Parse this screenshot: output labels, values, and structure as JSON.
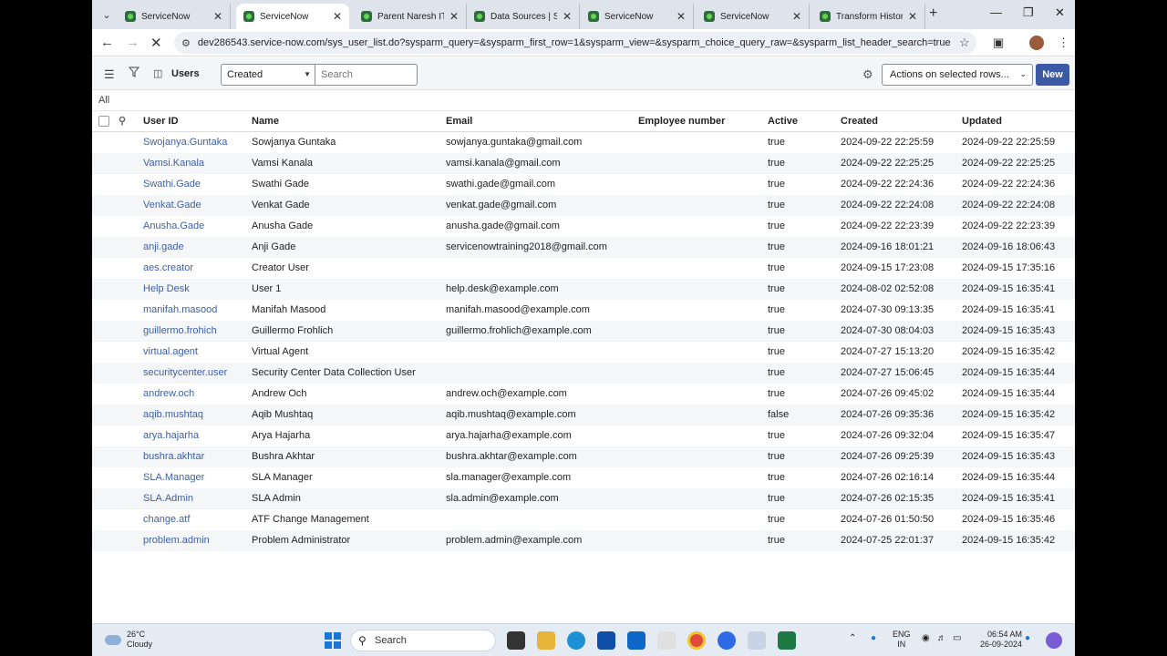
{
  "browser": {
    "tabs": [
      {
        "label": "ServiceNow",
        "active": false
      },
      {
        "label": "ServiceNow",
        "active": true
      },
      {
        "label": "Parent Naresh ITs",
        "active": false
      },
      {
        "label": "Data Sources | Ser",
        "active": false
      },
      {
        "label": "ServiceNow",
        "active": false
      },
      {
        "label": "ServiceNow",
        "active": false
      },
      {
        "label": "Transform Historic",
        "active": false
      }
    ],
    "url": "dev286543.service-now.com/sys_user_list.do?sysparm_query=&sysparm_first_row=1&sysparm_view=&sysparm_choice_query_raw=&sysparm_list_header_search=true"
  },
  "list": {
    "title": "Users",
    "search_field": "Created",
    "search_placeholder": "Search",
    "actions_label": "Actions on selected rows...",
    "new_label": "New",
    "breadcrumb": "All",
    "columns": [
      "User ID",
      "Name",
      "Email",
      "Employee number",
      "Active",
      "Created",
      "Updated"
    ],
    "rows": [
      [
        "Swojanya.Guntaka",
        "Sowjanya Guntaka",
        "sowjanya.guntaka@gmail.com",
        "",
        "true",
        "2024-09-22 22:25:59",
        "2024-09-22 22:25:59"
      ],
      [
        "Vamsi.Kanala",
        "Vamsi Kanala",
        "vamsi.kanala@gmail.com",
        "",
        "true",
        "2024-09-22 22:25:25",
        "2024-09-22 22:25:25"
      ],
      [
        "Swathi.Gade",
        "Swathi Gade",
        "swathi.gade@gmail.com",
        "",
        "true",
        "2024-09-22 22:24:36",
        "2024-09-22 22:24:36"
      ],
      [
        "Venkat.Gade",
        "Venkat Gade",
        "venkat.gade@gmail.com",
        "",
        "true",
        "2024-09-22 22:24:08",
        "2024-09-22 22:24:08"
      ],
      [
        "Anusha.Gade",
        "Anusha Gade",
        "anusha.gade@gmail.com",
        "",
        "true",
        "2024-09-22 22:23:39",
        "2024-09-22 22:23:39"
      ],
      [
        "anji.gade",
        "Anji Gade",
        "servicenowtraining2018@gmail.com",
        "",
        "true",
        "2024-09-16 18:01:21",
        "2024-09-16 18:06:43"
      ],
      [
        "aes.creator",
        "Creator User",
        "",
        "",
        "true",
        "2024-09-15 17:23:08",
        "2024-09-15 17:35:16"
      ],
      [
        "Help Desk",
        "User 1",
        "help.desk@example.com",
        "",
        "true",
        "2024-08-02 02:52:08",
        "2024-09-15 16:35:41"
      ],
      [
        "manifah.masood",
        "Manifah Masood",
        "manifah.masood@example.com",
        "",
        "true",
        "2024-07-30 09:13:35",
        "2024-09-15 16:35:41"
      ],
      [
        "guillermo.frohich",
        "Guillermo Frohlich",
        "guillermo.frohlich@example.com",
        "",
        "true",
        "2024-07-30 08:04:03",
        "2024-09-15 16:35:43"
      ],
      [
        "virtual.agent",
        "Virtual Agent",
        "",
        "",
        "true",
        "2024-07-27 15:13:20",
        "2024-09-15 16:35:42"
      ],
      [
        "securitycenter.user",
        "Security Center Data Collection User",
        "",
        "",
        "true",
        "2024-07-27 15:06:45",
        "2024-09-15 16:35:44"
      ],
      [
        "andrew.och",
        "Andrew Och",
        "andrew.och@example.com",
        "",
        "true",
        "2024-07-26 09:45:02",
        "2024-09-15 16:35:44"
      ],
      [
        "aqib.mushtaq",
        "Aqib Mushtaq",
        "aqib.mushtaq@example.com",
        "",
        "false",
        "2024-07-26 09:35:36",
        "2024-09-15 16:35:42"
      ],
      [
        "arya.hajarha",
        "Arya Hajarha",
        "arya.hajarha@example.com",
        "",
        "true",
        "2024-07-26 09:32:04",
        "2024-09-15 16:35:47"
      ],
      [
        "bushra.akhtar",
        "Bushra Akhtar",
        "bushra.akhtar@example.com",
        "",
        "true",
        "2024-07-26 09:25:39",
        "2024-09-15 16:35:43"
      ],
      [
        "SLA.Manager",
        "SLA Manager",
        "sla.manager@example.com",
        "",
        "true",
        "2024-07-26 02:16:14",
        "2024-09-15 16:35:44"
      ],
      [
        "SLA.Admin",
        "SLA Admin",
        "sla.admin@example.com",
        "",
        "true",
        "2024-07-26 02:15:35",
        "2024-09-15 16:35:41"
      ],
      [
        "change.atf",
        "ATF Change Management",
        "",
        "",
        "true",
        "2024-07-26 01:50:50",
        "2024-09-15 16:35:46"
      ],
      [
        "problem.admin",
        "Problem Administrator",
        "problem.admin@example.com",
        "",
        "true",
        "2024-07-25 22:01:37",
        "2024-09-15 16:35:42"
      ]
    ]
  },
  "taskbar": {
    "weather_temp": "26°C",
    "weather_desc": "Cloudy",
    "search_label": "Search",
    "lang_line1": "ENG",
    "lang_line2": "IN",
    "time": "06:54 AM",
    "date": "26-09-2024"
  },
  "colors": {
    "link": "#3c5fa9",
    "primary_button": "#3c59a8"
  }
}
